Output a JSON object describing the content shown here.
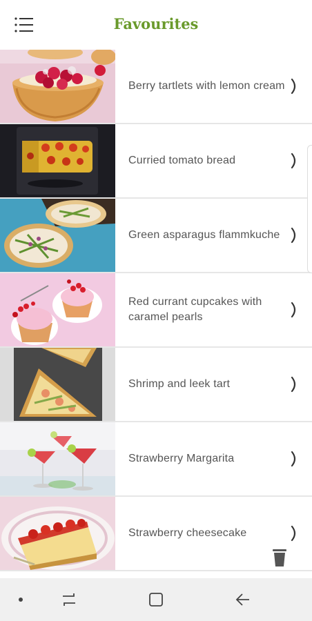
{
  "header": {
    "title": "Favourites",
    "menu_icon": "hamburger-menu-icon"
  },
  "colors": {
    "title_green": "#6a9a2c",
    "text_gray": "#555555",
    "chevron": "#333333",
    "divider": "#e6e6e6",
    "nav_bar_bg": "#f0f0f0",
    "nav_icon": "#444444"
  },
  "recipes": [
    {
      "title": "Berry tartlets with lemon cream",
      "chevron_icon": "chevron-right-icon"
    },
    {
      "title": "Curried tomato bread",
      "chevron_icon": "chevron-right-icon"
    },
    {
      "title": "Green asparagus flammkuche",
      "chevron_icon": "chevron-right-icon"
    },
    {
      "title": "Red currant cupcakes with caramel pearls",
      "chevron_icon": "chevron-right-icon"
    },
    {
      "title": "Shrimp and leek tart",
      "chevron_icon": "chevron-right-icon"
    },
    {
      "title": "Strawberry Margarita",
      "chevron_icon": "chevron-right-icon"
    },
    {
      "title": "Strawberry cheesecake",
      "chevron_icon": "chevron-right-icon"
    }
  ],
  "actions": {
    "delete_icon": "trash-icon"
  },
  "nav_bar": {
    "items": [
      "dot-icon",
      "recent-apps-icon",
      "home-icon",
      "back-icon"
    ]
  }
}
